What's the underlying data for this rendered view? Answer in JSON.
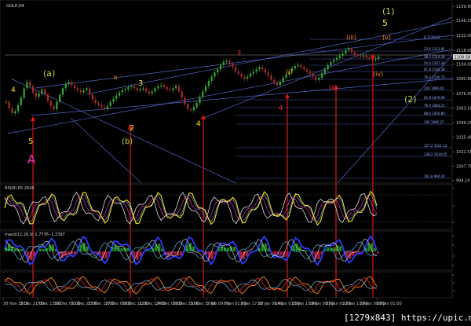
{
  "window": {
    "symbol_label": "GOLD,H4",
    "watermark": "[1279x843] https://upic.me/"
  },
  "colors": {
    "background": "#000000",
    "grid": "#1a1a1a",
    "candle_up": "#36a836",
    "candle_down": "#a82e2e",
    "trendline": "#5b6fd6",
    "fib": "#5266c8",
    "arrow": "#e01414",
    "yellow": "#f3e516",
    "orange": "#ff8a16",
    "red": "#ff3030",
    "lime": "#b3d94a",
    "magenta": "#ff2fb0",
    "axis_text": "#c8c8c8"
  },
  "chart_data": [
    {
      "type": "candlestick",
      "title": "GOLD,H4",
      "price_axis_ticks": [
        "1159.90",
        "1146.25",
        "1132.00",
        "1118.00",
        "1104.65",
        "1090.80",
        "1076.95",
        "1063.10",
        "1049.25",
        "1035.40",
        "1021.55",
        "1007.70",
        "994.10"
      ],
      "current_price_label": "1108.58",
      "time_axis_ticks": [
        "30 Nov 2015",
        "3 Dec 21:00",
        "7 Dec 13:00",
        "10 Dec 05:00",
        "11 Dec 21:00",
        "15 Dec 13:00",
        "17 Dec 05:00",
        "18 Dec 21:00",
        "22 Dec 13:00",
        "24 Dec 05:00",
        "28 Dec 21:00",
        "30 Dec 17:00",
        "5 Jan 09:00",
        "7 Jan 01:00",
        "8 Jan 17:00",
        "12 Jan 09:00",
        "14 Jan 01:00",
        "15 Jan 17:00",
        "19 Jan 09:00",
        "21 Jan 01:00",
        "22 Jan 17:00",
        "26 Jan 09:00",
        "28 Jan 01:00"
      ],
      "fib_levels": [
        {
          "label": "0 1120.03"
        },
        {
          "label": "23.6 1113.95"
        },
        {
          "label": "38.2 1110.30"
        },
        {
          "label": "50.0 1107.34"
        },
        {
          "label": "61.8 1104.38"
        },
        {
          "label": "76.4 1100.73"
        },
        {
          "label": "100 1094.65"
        },
        {
          "label": "61.8 1079.99"
        },
        {
          "label": "76.4 1064.21"
        },
        {
          "label": "88.6 1056.80"
        },
        {
          "label": "100 1046.27"
        },
        {
          "label": "127.2 1021.12"
        },
        {
          "label": "138.2 1014.05"
        },
        {
          "label": "161.8 994.20"
        }
      ],
      "wave_labels": [
        {
          "text": "4",
          "color": "yellow"
        },
        {
          "text": "(a)",
          "color": "lime"
        },
        {
          "text": "b",
          "color": "orange"
        },
        {
          "text": "3",
          "color": "yellow"
        },
        {
          "text": "5",
          "color": "yellow"
        },
        {
          "text": "A",
          "color": "magenta"
        },
        {
          "text": "2",
          "color": "yellow"
        },
        {
          "text": "(b)",
          "color": "lime"
        },
        {
          "text": "4",
          "color": "yellow"
        },
        {
          "text": "3",
          "color": "red"
        },
        {
          "text": "(i)",
          "color": "orange"
        },
        {
          "text": "(ii)",
          "color": "red"
        },
        {
          "text": "4",
          "color": "red"
        },
        {
          "text": "(iii)",
          "color": "orange"
        },
        {
          "text": "(1)",
          "color": "lime"
        },
        {
          "text": "5",
          "color": "yellow"
        },
        {
          "text": "(v)",
          "color": "orange"
        },
        {
          "text": "(iv)",
          "color": "orange"
        },
        {
          "text": "(2)",
          "color": "lime"
        }
      ],
      "close_series": [
        1069,
        1063,
        1058,
        1060,
        1066,
        1073,
        1082,
        1088,
        1084,
        1078,
        1074,
        1077,
        1081,
        1076,
        1070,
        1065,
        1062,
        1069,
        1076,
        1082,
        1086,
        1088,
        1085,
        1082,
        1080,
        1078,
        1080,
        1082,
        1076,
        1071,
        1068,
        1066,
        1064,
        1062,
        1065,
        1069,
        1072,
        1075,
        1078,
        1080,
        1081,
        1083,
        1084,
        1082,
        1080,
        1081,
        1082,
        1079,
        1077,
        1079,
        1082,
        1084,
        1085,
        1083,
        1081,
        1080,
        1082,
        1084,
        1079,
        1073,
        1067,
        1062,
        1061,
        1064,
        1068,
        1074,
        1079,
        1084,
        1089,
        1093,
        1097,
        1100,
        1104,
        1107,
        1108,
        1105,
        1102,
        1098,
        1096,
        1093,
        1091,
        1093,
        1096,
        1098,
        1100,
        1102,
        1100,
        1097,
        1094,
        1090,
        1087,
        1085,
        1088,
        1092,
        1095,
        1098,
        1101,
        1103,
        1104,
        1102,
        1100,
        1098,
        1096,
        1093,
        1090,
        1092,
        1096,
        1100,
        1104,
        1107,
        1109,
        1111,
        1113,
        1115,
        1118,
        1120,
        1116,
        1114,
        1113,
        1112,
        1113,
        1111,
        1110,
        1109,
        1110,
        1112
      ]
    },
    {
      "type": "line",
      "title": "RSI(8) 65.2926",
      "levels": [
        70,
        30
      ]
    },
    {
      "type": "histogram",
      "title": "macd(12,26,9) 1.7776 -1.2397"
    },
    {
      "type": "line",
      "title": ""
    }
  ]
}
